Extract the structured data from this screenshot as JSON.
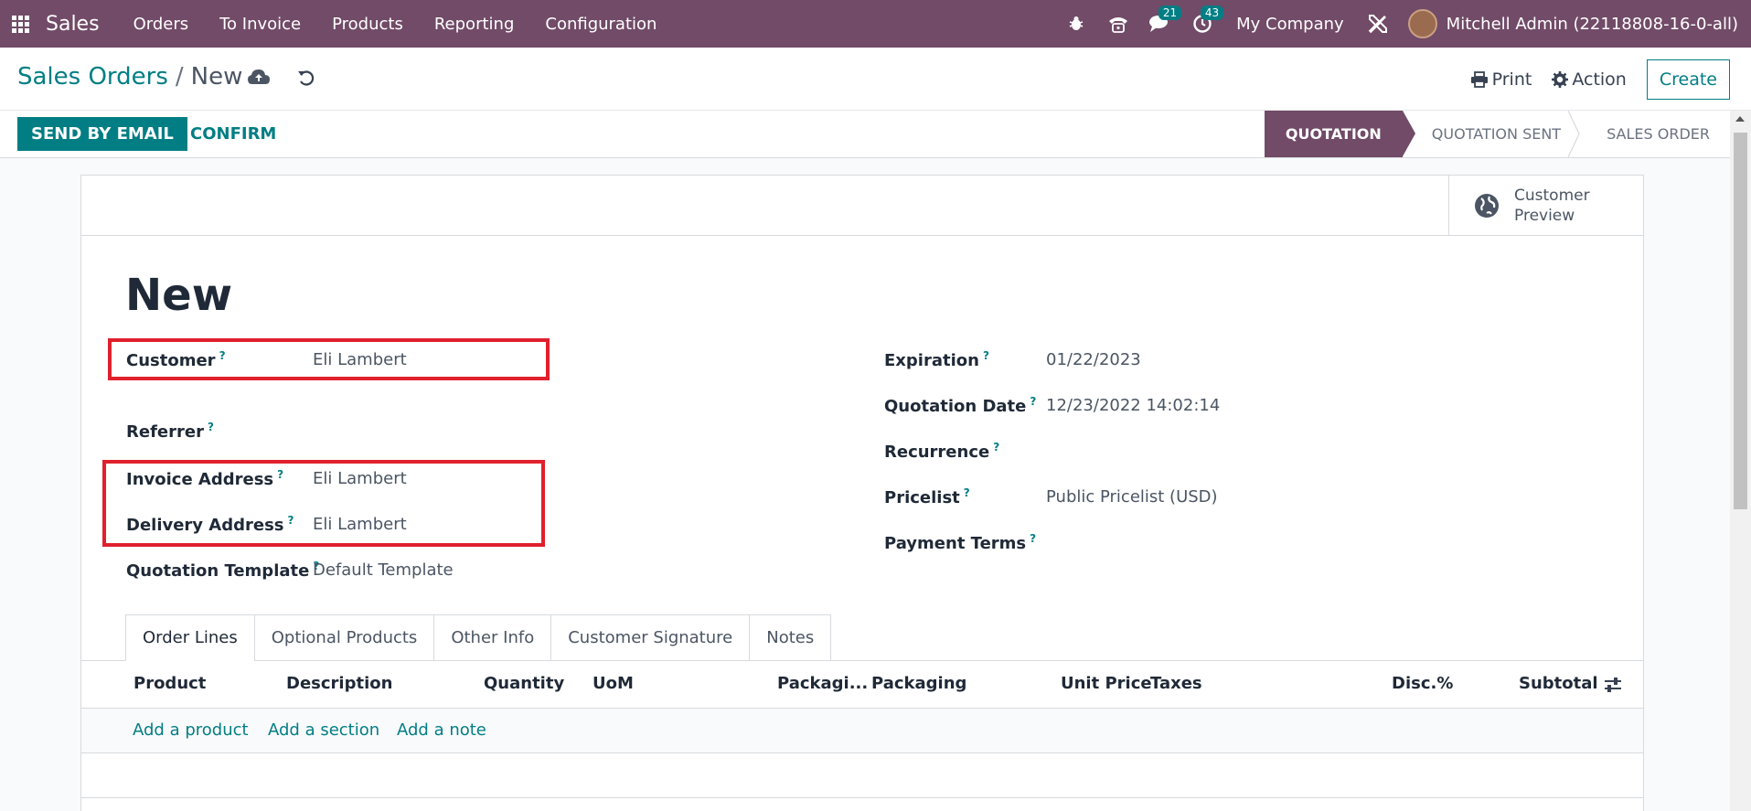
{
  "navbar": {
    "brand": "Sales",
    "menu": [
      "Orders",
      "To Invoice",
      "Products",
      "Reporting",
      "Configuration"
    ],
    "messages_count": "21",
    "activities_count": "43",
    "company": "My Company",
    "user": "Mitchell Admin (22118808-16-0-all)"
  },
  "control": {
    "breadcrumb_parent": "Sales Orders",
    "breadcrumb_sep": "/",
    "breadcrumb_current": "New",
    "print_label": "Print",
    "action_label": "Action",
    "create_label": "Create"
  },
  "statusbar": {
    "send_email_label": "SEND BY EMAIL",
    "confirm_label": "CONFIRM",
    "stages": [
      "QUOTATION",
      "QUOTATION SENT",
      "SALES ORDER"
    ]
  },
  "sheet": {
    "customer_preview": "Customer Preview",
    "title": "New",
    "help_mark": "?",
    "left_fields": {
      "customer": {
        "label": "Customer",
        "value": "Eli Lambert"
      },
      "referrer": {
        "label": "Referrer",
        "value": ""
      },
      "invoice_address": {
        "label": "Invoice Address",
        "value": "Eli Lambert"
      },
      "delivery_address": {
        "label": "Delivery Address",
        "value": "Eli Lambert"
      },
      "quotation_template": {
        "label": "Quotation Template",
        "value": "Default Template"
      }
    },
    "right_fields": {
      "expiration": {
        "label": "Expiration",
        "value": "01/22/2023"
      },
      "quotation_date": {
        "label": "Quotation Date",
        "value": "12/23/2022 14:02:14"
      },
      "recurrence": {
        "label": "Recurrence",
        "value": ""
      },
      "pricelist": {
        "label": "Pricelist",
        "value": "Public Pricelist (USD)"
      },
      "payment_terms": {
        "label": "Payment Terms",
        "value": ""
      }
    },
    "tabs": [
      "Order Lines",
      "Optional Products",
      "Other Info",
      "Customer Signature",
      "Notes"
    ],
    "columns": [
      "Product",
      "Description",
      "Quantity",
      "UoM",
      "Packagi...",
      "Packaging",
      "Unit Price",
      "Taxes",
      "Disc.%",
      "Subtotal"
    ],
    "add_links": [
      "Add a product",
      "Add a section",
      "Add a note"
    ]
  },
  "colors": {
    "brand": "#714b67",
    "accent": "#017e84",
    "highlight": "#e0202d"
  }
}
